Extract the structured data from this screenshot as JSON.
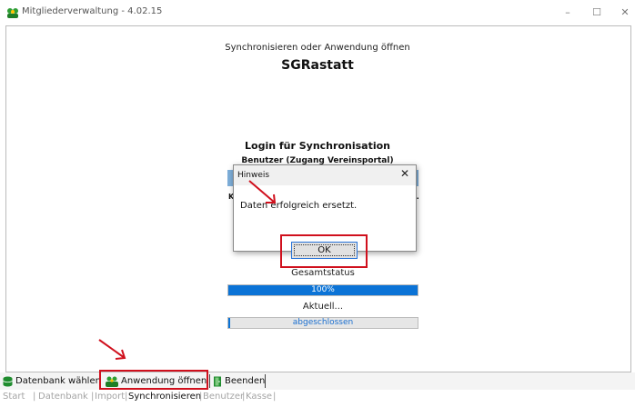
{
  "window": {
    "title": "Mitgliederverwaltung - 4.02.15",
    "minimize_glyph": "–",
    "maximize_glyph": "☐",
    "close_glyph": "✕"
  },
  "main": {
    "subtitle": "Synchronisieren oder Anwendung öffnen",
    "club_name": "SGRastatt",
    "login_title": "Login für Synchronisation",
    "user_label": "Benutzer (Zugang Vereinsportal)",
    "left_partial": "K",
    "right_partial": "n."
  },
  "dialog": {
    "title": "Hinweis",
    "close_glyph": "✕",
    "message": "Daten erfolgreich ersetzt.",
    "ok_label": "OK"
  },
  "status": {
    "total_label": "Gesamtstatus",
    "total_progress": 100,
    "total_text": "100%",
    "current_label": "Aktuell...",
    "current_text": "abgeschlossen"
  },
  "toolbar": {
    "database_label": "Datenbank wählen",
    "open_app_label": "Anwendung öffnen",
    "quit_label": "Beenden"
  },
  "tabs": [
    {
      "label": "Start"
    },
    {
      "label": "Datenbank"
    },
    {
      "label": "Import"
    },
    {
      "label": "Synchronisieren",
      "active": true
    },
    {
      "label": "Benutzer"
    },
    {
      "label": "Kasse"
    }
  ],
  "colors": {
    "accent": "#0b73d6",
    "highlight": "#d0101d"
  },
  "icons": [
    "app-icon",
    "database-icon",
    "users-icon",
    "exit-door-icon",
    "arrow-annotation-icon"
  ]
}
